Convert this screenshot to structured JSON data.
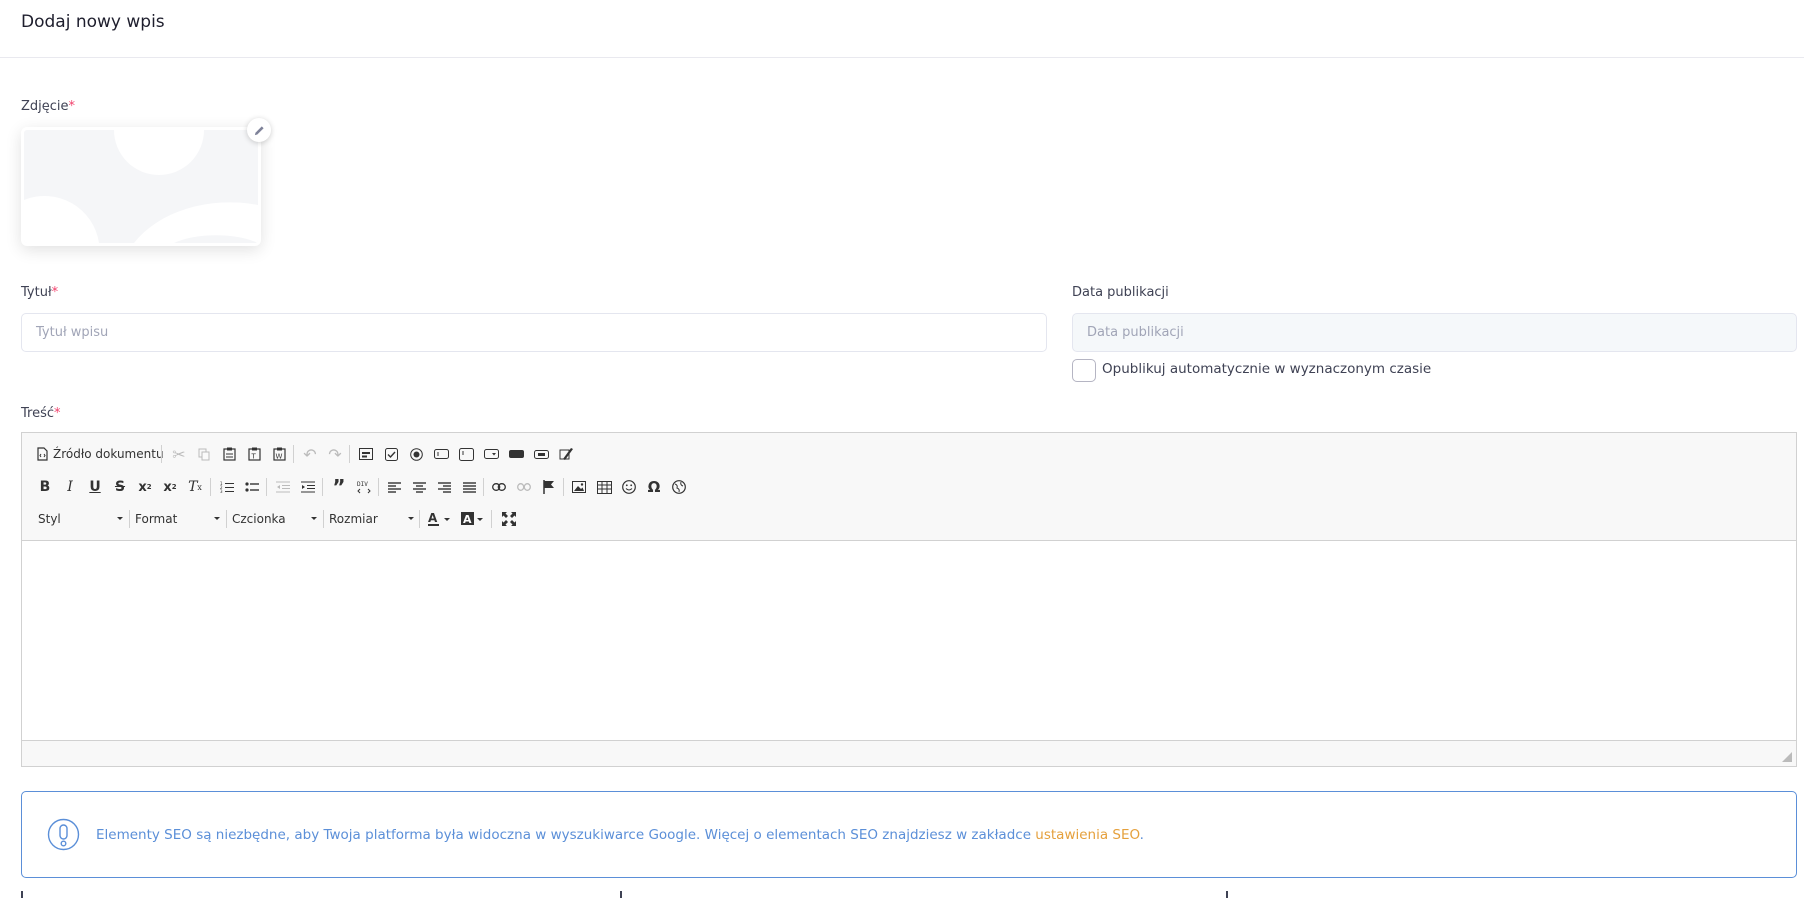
{
  "header": {
    "title": "Dodaj nowy wpis"
  },
  "form": {
    "photo": {
      "label": "Zdjęcie",
      "required_mark": "*"
    },
    "title": {
      "label": "Tytuł",
      "required_mark": "*",
      "placeholder": "Tytuł wpisu"
    },
    "publish_date": {
      "label": "Data publikacji",
      "placeholder": "Data publikacji"
    },
    "auto_publish": {
      "label": "Opublikuj automatycznie w wyznaczonym czasie",
      "checked": false
    },
    "content": {
      "label": "Treść",
      "required_mark": "*"
    }
  },
  "editor": {
    "source_label": "Źródło dokumentu",
    "combos": {
      "style": "Styl",
      "format": "Format",
      "font": "Czcionka",
      "size": "Rozmiar"
    },
    "icons": {
      "row1": [
        "cut-icon",
        "copy-icon",
        "paste-icon",
        "paste-text-icon",
        "paste-word-icon",
        "undo-icon",
        "redo-icon",
        "form-icon",
        "checkbox-icon",
        "radio-icon",
        "textfield-icon",
        "textarea-icon",
        "select-icon",
        "button-icon",
        "imagebutton-icon",
        "hiddenfield-icon"
      ],
      "row2": [
        "bold-icon",
        "italic-icon",
        "underline-icon",
        "strike-icon",
        "subscript-icon",
        "superscript-icon",
        "remove-format-icon",
        "numbered-list-icon",
        "bulleted-list-icon",
        "outdent-icon",
        "indent-icon",
        "blockquote-icon",
        "div-icon",
        "align-left-icon",
        "align-center-icon",
        "align-right-icon",
        "justify-icon",
        "link-icon",
        "unlink-icon",
        "anchor-icon",
        "image-icon",
        "table-icon",
        "smiley-icon",
        "special-char-icon",
        "iframe-icon"
      ],
      "row3": [
        "text-color-icon",
        "bg-color-icon",
        "maximize-icon"
      ]
    }
  },
  "seo_alert": {
    "text": "Elementy SEO są niezbędne, aby Twoja platforma była widoczna w wyszukiwarce Google. Więcej o elementach SEO znajdziesz w zakładce ",
    "link": "ustawienia SEO",
    "suffix": "."
  },
  "colors": {
    "alert_blue": "#5b8fd8",
    "link_orange": "#e5a03c",
    "required_red": "#f1416c"
  }
}
